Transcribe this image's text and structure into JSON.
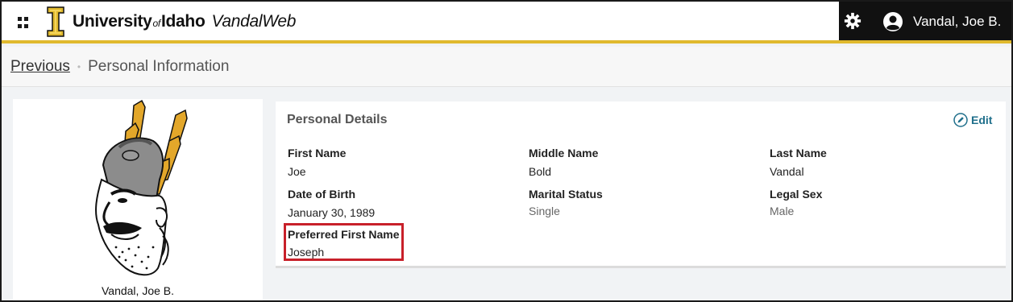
{
  "header": {
    "brand_university": "University",
    "brand_of": "of",
    "brand_idaho": "Idaho",
    "brand_app": "VandalWeb",
    "user_name": "Vandal, Joe B.",
    "accent_color": "#e0b92e",
    "icons": [
      "apps-grid-icon",
      "gear-icon",
      "user-avatar-icon"
    ]
  },
  "breadcrumb": {
    "previous": "Previous",
    "separator": "•",
    "current": "Personal Information"
  },
  "profile": {
    "photo_caption": "Vandal, Joe B."
  },
  "personal_details": {
    "title": "Personal Details",
    "edit_label": "Edit",
    "fields": {
      "first_name": {
        "label": "First Name",
        "value": "Joe"
      },
      "middle_name": {
        "label": "Middle Name",
        "value": "Bold"
      },
      "last_name": {
        "label": "Last Name",
        "value": "Vandal"
      },
      "date_of_birth": {
        "label": "Date of Birth",
        "value": "January 30, 1989"
      },
      "marital_status": {
        "label": "Marital Status",
        "value": "Single"
      },
      "legal_sex": {
        "label": "Legal Sex",
        "value": "Male"
      },
      "preferred_first_name": {
        "label": "Preferred First Name",
        "value": "Joseph"
      }
    },
    "highlight_color": "#c8202a"
  }
}
